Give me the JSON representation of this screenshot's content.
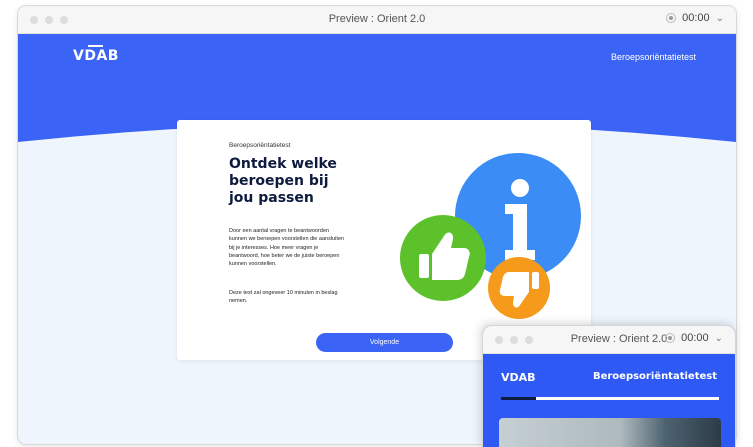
{
  "window": {
    "title": "Preview : Orient 2.0",
    "timer": "00:00"
  },
  "site": {
    "logo": "VDAB",
    "nav_link": "Beroepsoriëntatietest",
    "colors": {
      "primary": "#3b63f5",
      "background": "#eef5fd",
      "headline": "#0d1b3e"
    }
  },
  "card": {
    "eyebrow": "Beroepsoriëntatietest",
    "headline": "Ontdek welke beroepen bij jou passen",
    "paragraph1": "Door een aantal vragen te beantwoorden kunnen we beroepen voorstellen die aansluiten bij je interesses. Hoe meer vragen je beantwoord, hoe beter we de juiste beroepen kunnen voorstellen.",
    "paragraph2": "Deze test zal ongeveer 10 minuten in beslag nemen.",
    "next_button": "Volgende",
    "illustration": {
      "icons": [
        "info-icon",
        "thumbs-up-icon",
        "thumbs-down-icon"
      ],
      "colors": {
        "info": "#3b8cf5",
        "thumbs_up": "#5cc12b",
        "thumbs_down": "#f59a1b"
      }
    }
  },
  "mini_window": {
    "title": "Preview : Orient 2.0",
    "timer": "00:00",
    "logo": "VDAB",
    "heading": "Beroepsoriëntatietest",
    "progress": 0.16
  }
}
